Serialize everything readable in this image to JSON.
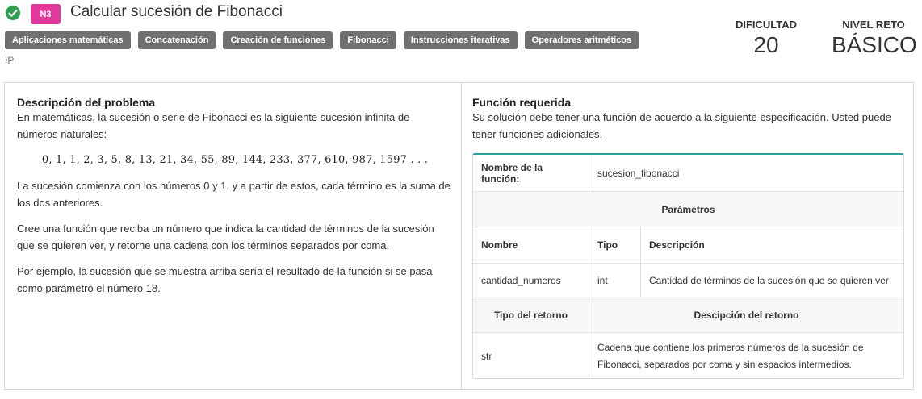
{
  "header": {
    "level_badge": "N3",
    "title": "Calcular sucesión de Fibonacci",
    "tags": [
      "Aplicaciones matemáticas",
      "Concatenación",
      "Creación de funciones",
      "Fibonacci",
      "Instrucciones iterativas",
      "Operadores aritméticos"
    ],
    "course": "IP",
    "difficulty_label": "DIFICULTAD",
    "difficulty_value": "20",
    "level_label": "NIVEL RETO",
    "level_value": "BÁSICO"
  },
  "description": {
    "title": "Descripción del problema",
    "intro": "En matemáticas, la sucesión o serie de Fibonacci es la siguiente sucesión infinita de números naturales:",
    "sequence": "0, 1, 1, 2, 3, 5, 8, 13, 21, 34, 55, 89, 144, 233, 377, 610, 987, 1597 . . .",
    "p1": "La sucesión comienza con los números 0 y 1, y a partir de estos, cada término es la suma de los dos anteriores.",
    "p2": "Cree una función que reciba un número que indica la cantidad de términos de la sucesión que se quieren ver, y retorne una cadena con los términos separados por coma.",
    "p3": "Por ejemplo, la sucesión que se muestra arriba sería el resultado de la función si se pasa como parámetro el número 18."
  },
  "function_spec": {
    "title": "Función requerida",
    "intro": "Su solución debe tener una función de acuerdo a la siguiente especificación. Usted puede tener funciones adicionales.",
    "name_label": "Nombre de la función:",
    "name_value": "sucesion_fibonacci",
    "params_label": "Parámetros",
    "col_name": "Nombre",
    "col_type": "Tipo",
    "col_desc": "Descripción",
    "param_name": "cantidad_numeros",
    "param_type": "int",
    "param_desc": "Cantidad de términos de la sucesión que se quieren ver",
    "return_type_label": "Tipo del retorno",
    "return_desc_label": "Descipción del retorno",
    "return_type": "str",
    "return_desc": "Cadena que contiene los primeros números de la sucesión de Fibonacci, separados por coma y sin espacios intermedios."
  }
}
